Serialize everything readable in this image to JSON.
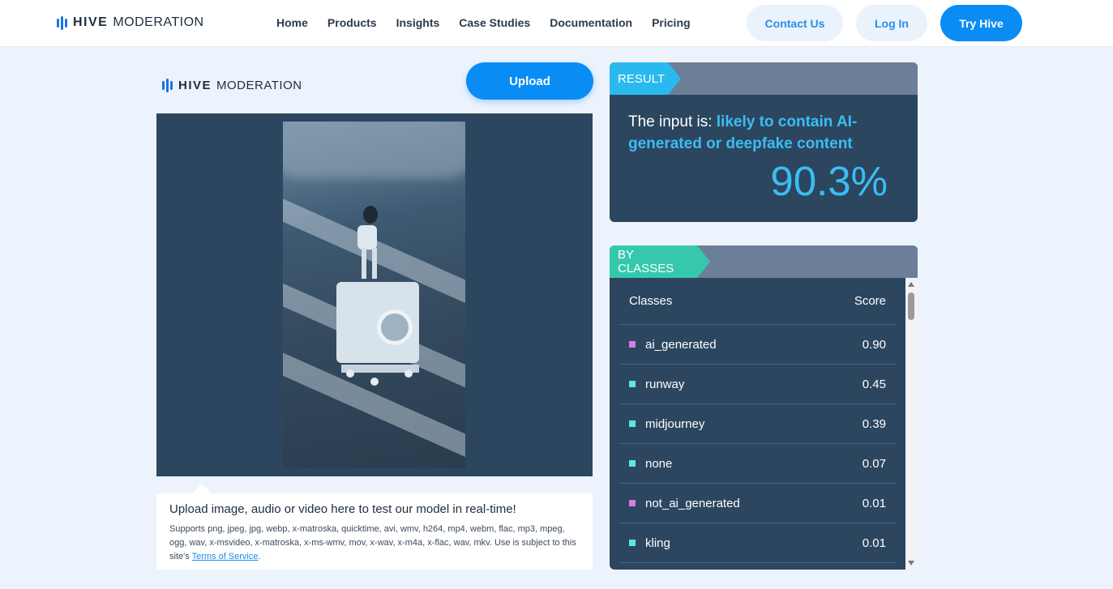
{
  "nav": {
    "logo_hive": "HIVE",
    "logo_moderation": "MODERATION",
    "links": [
      "Home",
      "Products",
      "Insights",
      "Case Studies",
      "Documentation",
      "Pricing"
    ],
    "contact": "Contact Us",
    "login": "Log In",
    "try": "Try Hive"
  },
  "left": {
    "logo_hive": "HIVE",
    "logo_moderation": "MODERATION",
    "upload": "Upload",
    "caption_title": "Upload image, audio or video here to test our model in real-time!",
    "caption_text": "Supports png, jpeg, jpg, webp, x-matroska, quicktime, avi, wmv, h264, mp4, webm, flac, mp3, mpeg, ogg, wav, x-msvideo, x-matroska, x-ms-wmv, mov, x-wav, x-m4a, x-flac, wav, mkv. Use is subject to this site's ",
    "tos_link": "Terms of Service",
    "caption_end": "."
  },
  "result": {
    "tag": "RESULT",
    "prefix": "The input is: ",
    "verdict": "likely to contain AI-generated or deepfake content",
    "percent": "90.3%"
  },
  "classes": {
    "tag": "BY CLASSES",
    "col_class": "Classes",
    "col_score": "Score",
    "rows": [
      {
        "name": "ai_generated",
        "score": "0.90",
        "color": "#d17ee6"
      },
      {
        "name": "runway",
        "score": "0.45",
        "color": "#5ee6e0"
      },
      {
        "name": "midjourney",
        "score": "0.39",
        "color": "#5ee6e0"
      },
      {
        "name": "none",
        "score": "0.07",
        "color": "#5ee6e0"
      },
      {
        "name": "not_ai_generated",
        "score": "0.01",
        "color": "#d17ee6"
      },
      {
        "name": "kling",
        "score": "0.01",
        "color": "#5ee6e0"
      }
    ]
  }
}
